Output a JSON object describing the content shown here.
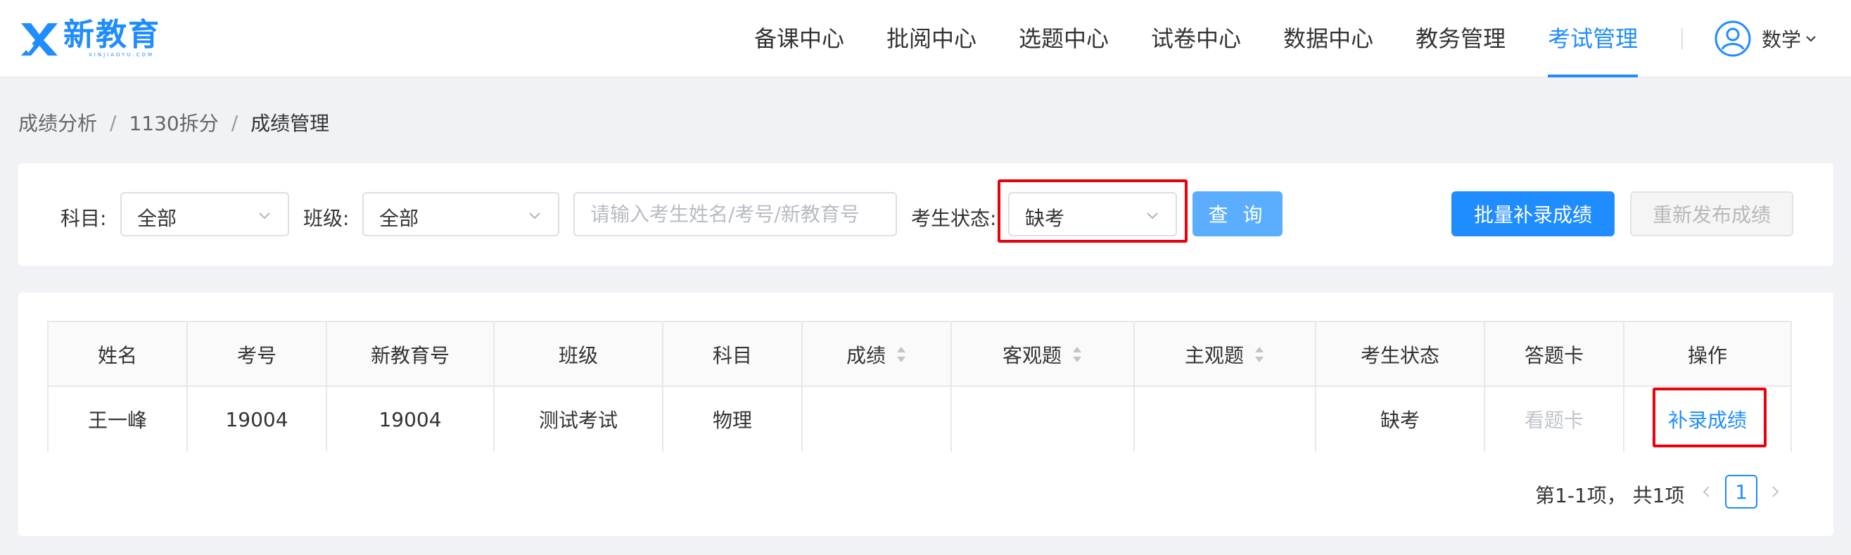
{
  "brand": {
    "name": "新教育",
    "tagline": "XINJIAOYU.COM",
    "color": "#1f8cff"
  },
  "nav": {
    "items": [
      {
        "label": "备课中心",
        "active": false
      },
      {
        "label": "批阅中心",
        "active": false
      },
      {
        "label": "选题中心",
        "active": false
      },
      {
        "label": "试卷中心",
        "active": false
      },
      {
        "label": "数据中心",
        "active": false
      },
      {
        "label": "教务管理",
        "active": false
      },
      {
        "label": "考试管理",
        "active": true
      }
    ],
    "user": {
      "name": "数学",
      "icon": "user-circle-icon"
    }
  },
  "breadcrumb": {
    "items": [
      "成绩分析",
      "1130拆分",
      "成绩管理"
    ],
    "separator": "/"
  },
  "filters": {
    "subject": {
      "label": "科目:",
      "value": "全部"
    },
    "class": {
      "label": "班级:",
      "value": "全部"
    },
    "search": {
      "placeholder": "请输入考生姓名/考号/新教育号",
      "value": ""
    },
    "status": {
      "label": "考生状态:",
      "value": "缺考"
    },
    "query_label": "查 询",
    "batch_label": "批量补录成绩",
    "republish_label": "重新发布成绩"
  },
  "table": {
    "headers": [
      "姓名",
      "考号",
      "新教育号",
      "班级",
      "科目",
      "成绩",
      "客观题",
      "主观题",
      "考生状态",
      "答题卡",
      "操作"
    ],
    "sortable": [
      false,
      false,
      false,
      false,
      false,
      true,
      true,
      true,
      false,
      false,
      false
    ],
    "rows": [
      {
        "name": "王一峰",
        "exam_no": "19004",
        "xjy_no": "19004",
        "class": "测试考试",
        "subject": "物理",
        "score": "",
        "objective": "",
        "subjective": "",
        "status": "缺考",
        "answer_card": "看题卡",
        "action": "补录成绩"
      }
    ]
  },
  "pagination": {
    "summary": "第1-1项， 共1项",
    "current_page": "1"
  },
  "colors": {
    "accent": "#1f8cff",
    "highlight": "#e8000b",
    "background": "#f0f2f5"
  }
}
